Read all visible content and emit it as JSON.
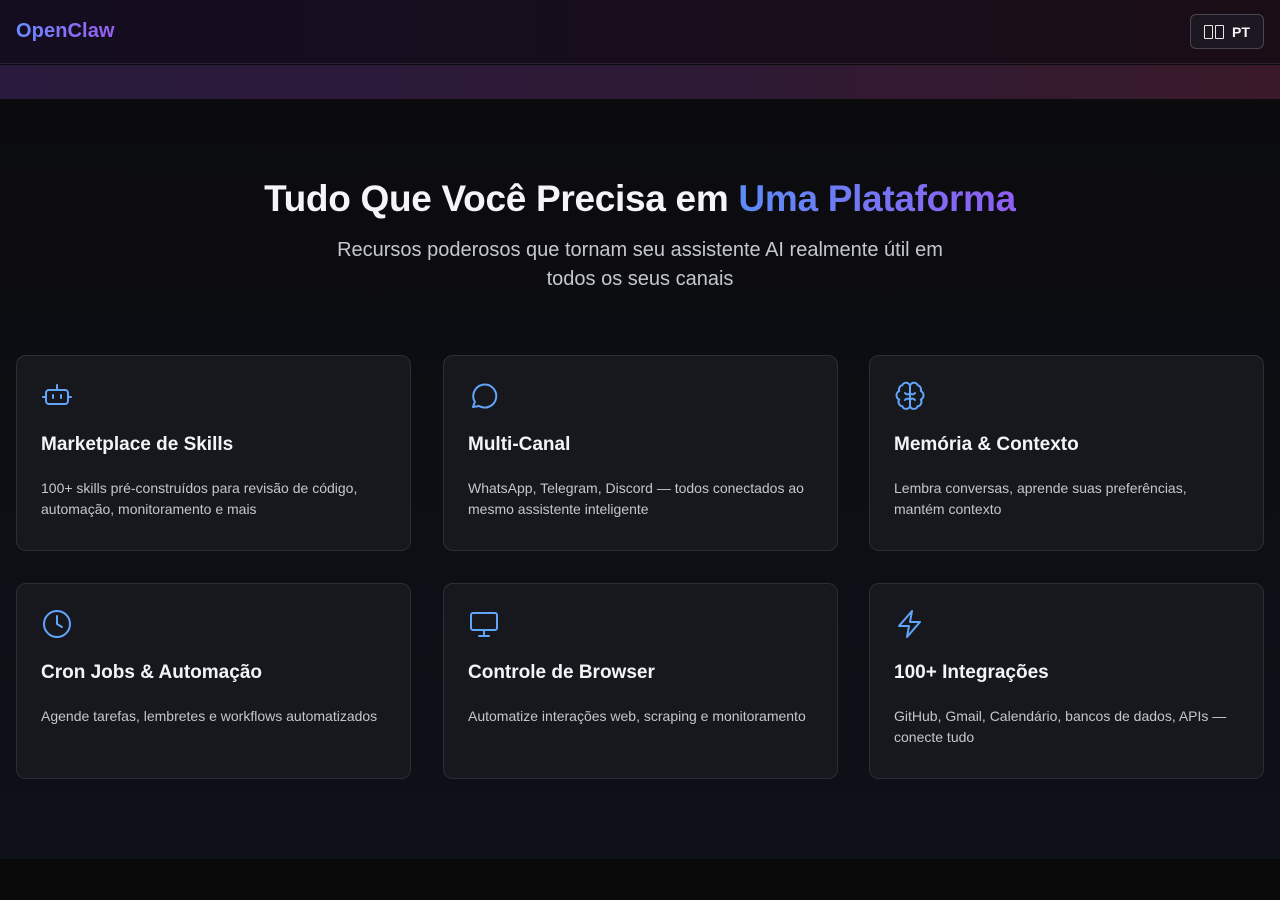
{
  "header": {
    "logo": "OpenClaw",
    "language_button": "PT",
    "language_icon": "flag-icon"
  },
  "hero": {
    "title_main": "Tudo Que Você Precisa em ",
    "title_accent": "Uma Plataforma",
    "subtitle": "Recursos poderosos que tornam seu assistente AI realmente útil em todos os seus canais"
  },
  "colors": {
    "accent_blue": "#5b8cf6",
    "accent_purple": "#8f5ef2",
    "icon_blue": "#60a5fa"
  },
  "features": [
    {
      "icon": "robot-icon",
      "title": "Marketplace de Skills",
      "description": "100+ skills pré-construídos para revisão de código, automação, monitoramento e mais"
    },
    {
      "icon": "chat-bubble-icon",
      "title": "Multi-Canal",
      "description": "WhatsApp, Telegram, Discord — todos conectados ao mesmo assistente inteligente"
    },
    {
      "icon": "brain-icon",
      "title": "Memória & Contexto",
      "description": "Lembra conversas, aprende suas preferências, mantém contexto"
    },
    {
      "icon": "clock-icon",
      "title": "Cron Jobs & Automação",
      "description": "Agende tarefas, lembretes e workflows automatizados"
    },
    {
      "icon": "monitor-icon",
      "title": "Controle de Browser",
      "description": "Automatize interações web, scraping e monitoramento"
    },
    {
      "icon": "lightning-icon",
      "title": "100+ Integrações",
      "description": "GitHub, Gmail, Calendário, bancos de dados, APIs — conecte tudo"
    }
  ]
}
